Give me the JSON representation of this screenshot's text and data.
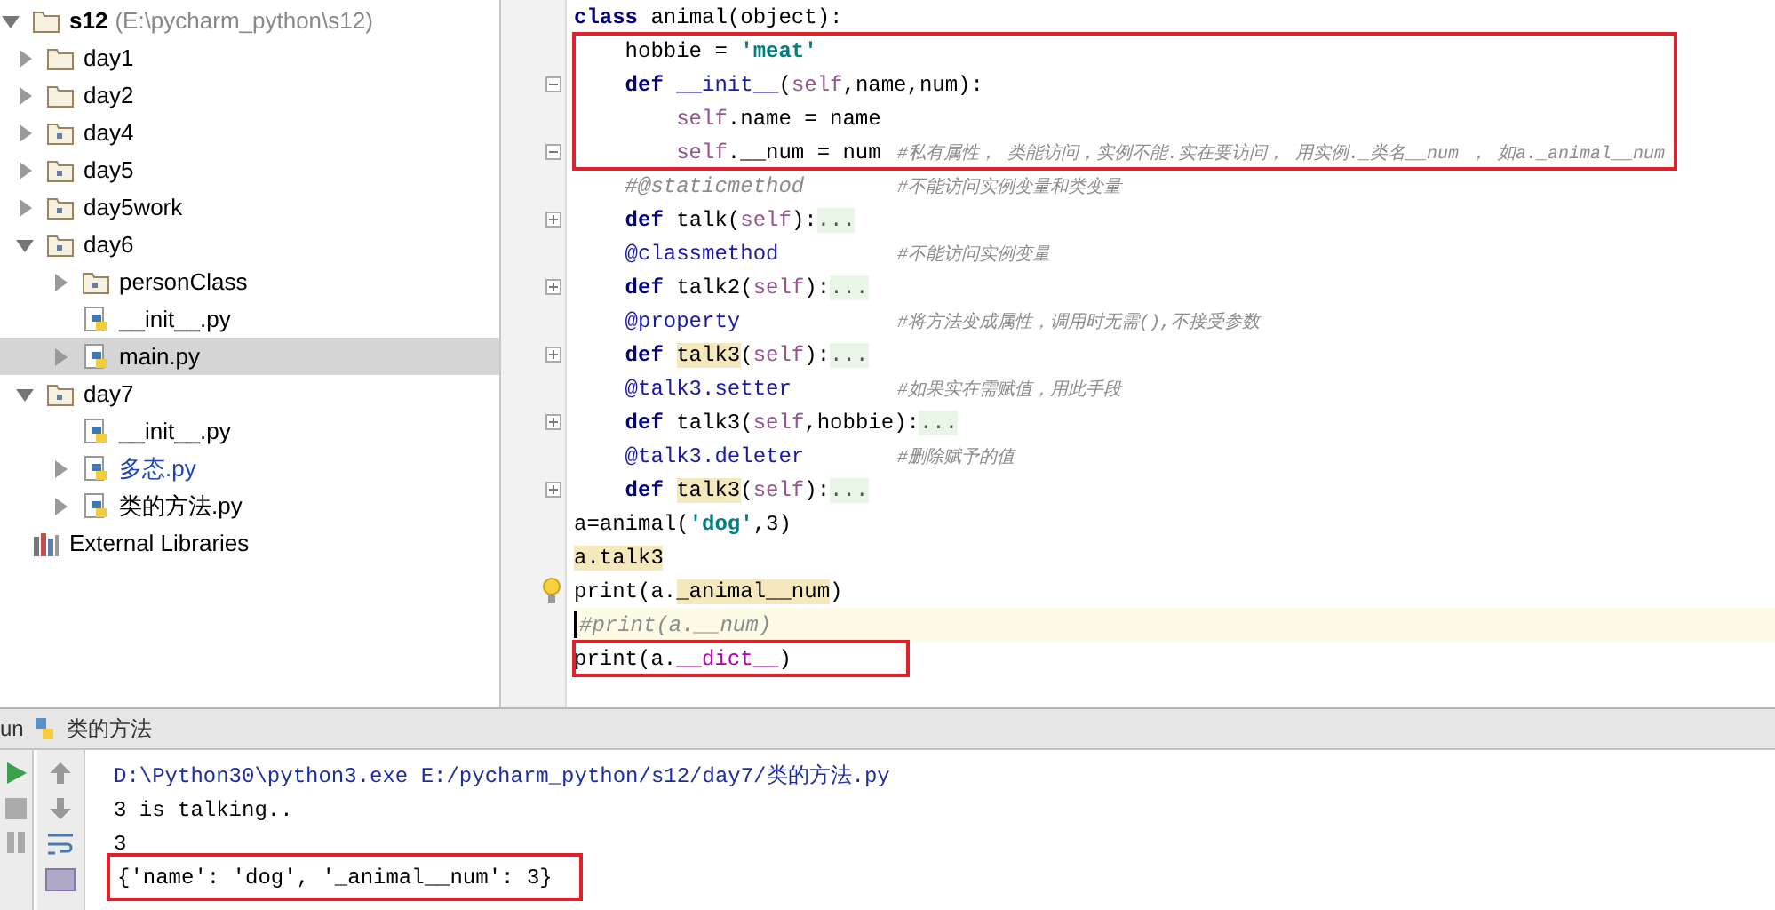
{
  "project_tree": [
    {
      "label": "s12",
      "path": "(E:\\pycharm_python\\s12)",
      "kind": "root",
      "expanded": true,
      "selected": false,
      "modified": false,
      "children": [
        {
          "label": "day1",
          "kind": "folder",
          "expanded": false,
          "selected": false,
          "modified": false
        },
        {
          "label": "day2",
          "kind": "folder",
          "expanded": false,
          "selected": false,
          "modified": false
        },
        {
          "label": "day4",
          "kind": "package",
          "expanded": false,
          "selected": false,
          "modified": false
        },
        {
          "label": "day5",
          "kind": "package",
          "expanded": false,
          "selected": false,
          "modified": false
        },
        {
          "label": "day5work",
          "kind": "package",
          "expanded": false,
          "selected": false,
          "modified": false
        },
        {
          "label": "day6",
          "kind": "package",
          "expanded": true,
          "selected": false,
          "modified": false,
          "children": [
            {
              "label": "personClass",
              "kind": "package",
              "expanded": false,
              "selected": false,
              "modified": false
            },
            {
              "label": "__init__.py",
              "kind": "python",
              "selected": false,
              "modified": false
            },
            {
              "label": "main.py",
              "kind": "python",
              "expanded": false,
              "selected": true,
              "modified": false
            }
          ]
        },
        {
          "label": "day7",
          "kind": "package",
          "expanded": true,
          "selected": false,
          "modified": false,
          "children": [
            {
              "label": "__init__.py",
              "kind": "python",
              "selected": false,
              "modified": false
            },
            {
              "label": "多态.py",
              "kind": "python",
              "expanded": false,
              "selected": false,
              "modified": true
            },
            {
              "label": "类的方法.py",
              "kind": "python",
              "expanded": false,
              "selected": false,
              "modified": false
            }
          ]
        }
      ]
    },
    {
      "label": "External Libraries",
      "kind": "library",
      "selected": false,
      "modified": false
    }
  ],
  "editor": {
    "lines": [
      {
        "fold_open": false,
        "fold_close": false,
        "collapsed": false,
        "current": false,
        "boxed": false,
        "bulb": false,
        "tokens": [
          {
            "kind": "keyword",
            "text": "class"
          },
          {
            "kind": "plain",
            "text": " animal(object):"
          }
        ]
      },
      {
        "fold_open": false,
        "fold_close": false,
        "collapsed": false,
        "current": false,
        "boxed": true,
        "bulb": false,
        "tokens": [
          {
            "kind": "plain",
            "text": "    hobbie = "
          },
          {
            "kind": "string",
            "text": "'meat'"
          }
        ]
      },
      {
        "fold_open": true,
        "fold_close": false,
        "collapsed": false,
        "current": false,
        "boxed": true,
        "bulb": false,
        "tokens": [
          {
            "kind": "keyword",
            "text": "    def"
          },
          {
            "kind": "magic",
            "text": " __init__"
          },
          {
            "kind": "plain",
            "text": "("
          },
          {
            "kind": "self",
            "text": "self"
          },
          {
            "kind": "plain",
            "text": ",name,num):"
          }
        ]
      },
      {
        "fold_open": false,
        "fold_close": false,
        "collapsed": false,
        "current": false,
        "boxed": true,
        "bulb": false,
        "tokens": [
          {
            "kind": "self",
            "text": "        self"
          },
          {
            "kind": "plain",
            "text": ".name = name"
          }
        ]
      },
      {
        "fold_open": false,
        "fold_close": true,
        "collapsed": false,
        "current": false,
        "boxed": true,
        "bulb": false,
        "tokens": [
          {
            "kind": "self",
            "text": "        self"
          },
          {
            "kind": "plain",
            "text": ".__num = num"
          }
        ],
        "comment": "#私有属性， 类能访问，实例不能.实在要访问， 用实例._类名__num ， 如a._animal__num"
      },
      {
        "fold_open": false,
        "fold_close": false,
        "collapsed": false,
        "current": false,
        "boxed": false,
        "bulb": false,
        "tokens": [
          {
            "kind": "comment",
            "text": "    #@staticmethod"
          }
        ],
        "comment": "#不能访问实例变量和类变量"
      },
      {
        "fold_open": false,
        "fold_close": false,
        "collapsed": true,
        "current": false,
        "boxed": false,
        "bulb": false,
        "tokens": [
          {
            "kind": "keyword",
            "text": "    def"
          },
          {
            "kind": "plain",
            "text": " talk("
          },
          {
            "kind": "self",
            "text": "self"
          },
          {
            "kind": "plain",
            "text": "):"
          },
          {
            "kind": "folded",
            "text": "..."
          }
        ]
      },
      {
        "fold_open": false,
        "fold_close": false,
        "collapsed": false,
        "current": false,
        "boxed": false,
        "bulb": false,
        "tokens": [
          {
            "kind": "decorator",
            "text": "    @classmethod"
          }
        ],
        "comment": "#不能访问实例变量"
      },
      {
        "fold_open": false,
        "fold_close": false,
        "collapsed": true,
        "current": false,
        "boxed": false,
        "bulb": false,
        "tokens": [
          {
            "kind": "keyword",
            "text": "    def"
          },
          {
            "kind": "plain",
            "text": " talk2("
          },
          {
            "kind": "self",
            "text": "self"
          },
          {
            "kind": "plain",
            "text": "):"
          },
          {
            "kind": "folded",
            "text": "..."
          }
        ]
      },
      {
        "fold_open": false,
        "fold_close": false,
        "collapsed": false,
        "current": false,
        "boxed": false,
        "bulb": false,
        "tokens": [
          {
            "kind": "decorator",
            "text": "    @property"
          }
        ],
        "comment": "#将方法变成属性，调用时无需(),不接受参数"
      },
      {
        "fold_open": false,
        "fold_close": false,
        "collapsed": true,
        "current": false,
        "boxed": false,
        "bulb": false,
        "tokens": [
          {
            "kind": "keyword",
            "text": "    def "
          },
          {
            "kind": "usage",
            "text": "talk3"
          },
          {
            "kind": "plain",
            "text": "("
          },
          {
            "kind": "self",
            "text": "self"
          },
          {
            "kind": "plain",
            "text": "):"
          },
          {
            "kind": "folded",
            "text": "..."
          }
        ]
      },
      {
        "fold_open": false,
        "fold_close": false,
        "collapsed": false,
        "current": false,
        "boxed": false,
        "bulb": false,
        "tokens": [
          {
            "kind": "decorator",
            "text": "    @talk3.setter"
          }
        ],
        "comment": "#如果实在需赋值，用此手段"
      },
      {
        "fold_open": false,
        "fold_close": false,
        "collapsed": true,
        "current": false,
        "boxed": false,
        "bulb": false,
        "tokens": [
          {
            "kind": "keyword",
            "text": "    def"
          },
          {
            "kind": "plain",
            "text": " talk3("
          },
          {
            "kind": "self",
            "text": "self"
          },
          {
            "kind": "plain",
            "text": ",hobbie):"
          },
          {
            "kind": "folded",
            "text": "..."
          }
        ]
      },
      {
        "fold_open": false,
        "fold_close": false,
        "collapsed": false,
        "current": false,
        "boxed": false,
        "bulb": false,
        "tokens": [
          {
            "kind": "decorator",
            "text": "    @talk3.deleter"
          }
        ],
        "comment": "#删除赋予的值"
      },
      {
        "fold_open": false,
        "fold_close": false,
        "collapsed": true,
        "current": false,
        "boxed": false,
        "bulb": false,
        "tokens": [
          {
            "kind": "keyword",
            "text": "    def "
          },
          {
            "kind": "usage",
            "text": "talk3"
          },
          {
            "kind": "plain",
            "text": "("
          },
          {
            "kind": "self",
            "text": "self"
          },
          {
            "kind": "plain",
            "text": "):"
          },
          {
            "kind": "folded",
            "text": "..."
          }
        ]
      },
      {
        "fold_open": false,
        "fold_close": false,
        "collapsed": false,
        "current": false,
        "boxed": false,
        "bulb": false,
        "tokens": [
          {
            "kind": "plain",
            "text": "a=animal("
          },
          {
            "kind": "string",
            "text": "'dog'"
          },
          {
            "kind": "plain",
            "text": ",3)"
          }
        ]
      },
      {
        "fold_open": false,
        "fold_close": false,
        "collapsed": false,
        "current": false,
        "boxed": false,
        "bulb": false,
        "tokens": [
          {
            "kind": "usage",
            "text": "a.talk3"
          }
        ]
      },
      {
        "fold_open": false,
        "fold_close": false,
        "collapsed": false,
        "current": false,
        "boxed": false,
        "bulb": true,
        "tokens": [
          {
            "kind": "plain",
            "text": "print(a."
          },
          {
            "kind": "usage",
            "text": "_animal__num"
          },
          {
            "kind": "plain",
            "text": ")"
          }
        ]
      },
      {
        "fold_open": false,
        "fold_close": false,
        "collapsed": false,
        "current": true,
        "boxed": false,
        "bulb": false,
        "tokens": [
          {
            "kind": "comment",
            "text": "#print(a.__num)"
          }
        ]
      },
      {
        "fold_open": false,
        "fold_close": false,
        "collapsed": false,
        "current": false,
        "boxed": true,
        "bulb": false,
        "tokens": [
          {
            "kind": "plain",
            "text": "print(a."
          },
          {
            "kind": "dunder",
            "text": "__dict__"
          },
          {
            "kind": "plain",
            "text": ")"
          }
        ]
      }
    ]
  },
  "run_panel": {
    "label": "un",
    "config": "类的方法",
    "output": [
      {
        "kind": "command",
        "text": "D:\\Python30\\python3.exe E:/pycharm_python/s12/day7/类的方法.py",
        "boxed": false
      },
      {
        "kind": "stdout",
        "text": "3 is talking..",
        "boxed": false
      },
      {
        "kind": "stdout",
        "text": "3",
        "boxed": false
      },
      {
        "kind": "stdout",
        "text": "{'name': 'dog', '_animal__num': 3}",
        "boxed": true
      }
    ]
  }
}
